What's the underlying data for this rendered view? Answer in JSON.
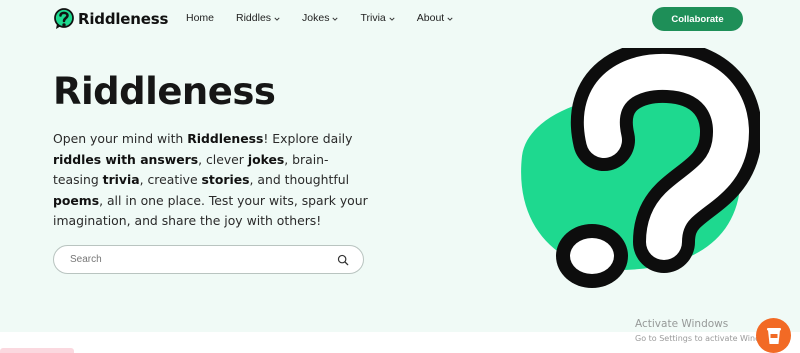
{
  "header": {
    "brand": "Riddleness",
    "nav": [
      {
        "label": "Home",
        "has_caret": false
      },
      {
        "label": "Riddles",
        "has_caret": true
      },
      {
        "label": "Jokes",
        "has_caret": true
      },
      {
        "label": "Trivia",
        "has_caret": true
      },
      {
        "label": "About",
        "has_caret": true
      }
    ],
    "cta_label": "Collaborate"
  },
  "hero": {
    "title": "Riddleness",
    "description": [
      {
        "text": "Open your mind with ",
        "bold": false
      },
      {
        "text": "Riddleness",
        "bold": true
      },
      {
        "text": "! Explore daily ",
        "bold": false
      },
      {
        "text": "riddles with answers",
        "bold": true
      },
      {
        "text": ", clever ",
        "bold": false
      },
      {
        "text": "jokes",
        "bold": true
      },
      {
        "text": ", brain-teasing ",
        "bold": false
      },
      {
        "text": "trivia",
        "bold": true
      },
      {
        "text": ", creative ",
        "bold": false
      },
      {
        "text": "stories",
        "bold": true
      },
      {
        "text": ", and thoughtful ",
        "bold": false
      },
      {
        "text": "poems",
        "bold": true
      },
      {
        "text": ", all in one place. Test your wits, spark your imagination, and share the joy with others!",
        "bold": false
      }
    ],
    "search_placeholder": "Search",
    "art_icon": "question-mark-illustration"
  },
  "windows_notice": {
    "title": "Activate Windows",
    "subtitle": "Go to Settings to activate Windows."
  },
  "icons": {
    "logo": "question-bubble-logo",
    "search": "magnifier-icon",
    "caret": "chevron-down-icon",
    "floating": "coffee-cup-icon"
  },
  "colors": {
    "background": "#f0faf6",
    "brand_green": "#1e8f58",
    "blob_green": "#1ed98f",
    "coffee_orange": "#f26a25",
    "text": "#1b1b1b"
  }
}
